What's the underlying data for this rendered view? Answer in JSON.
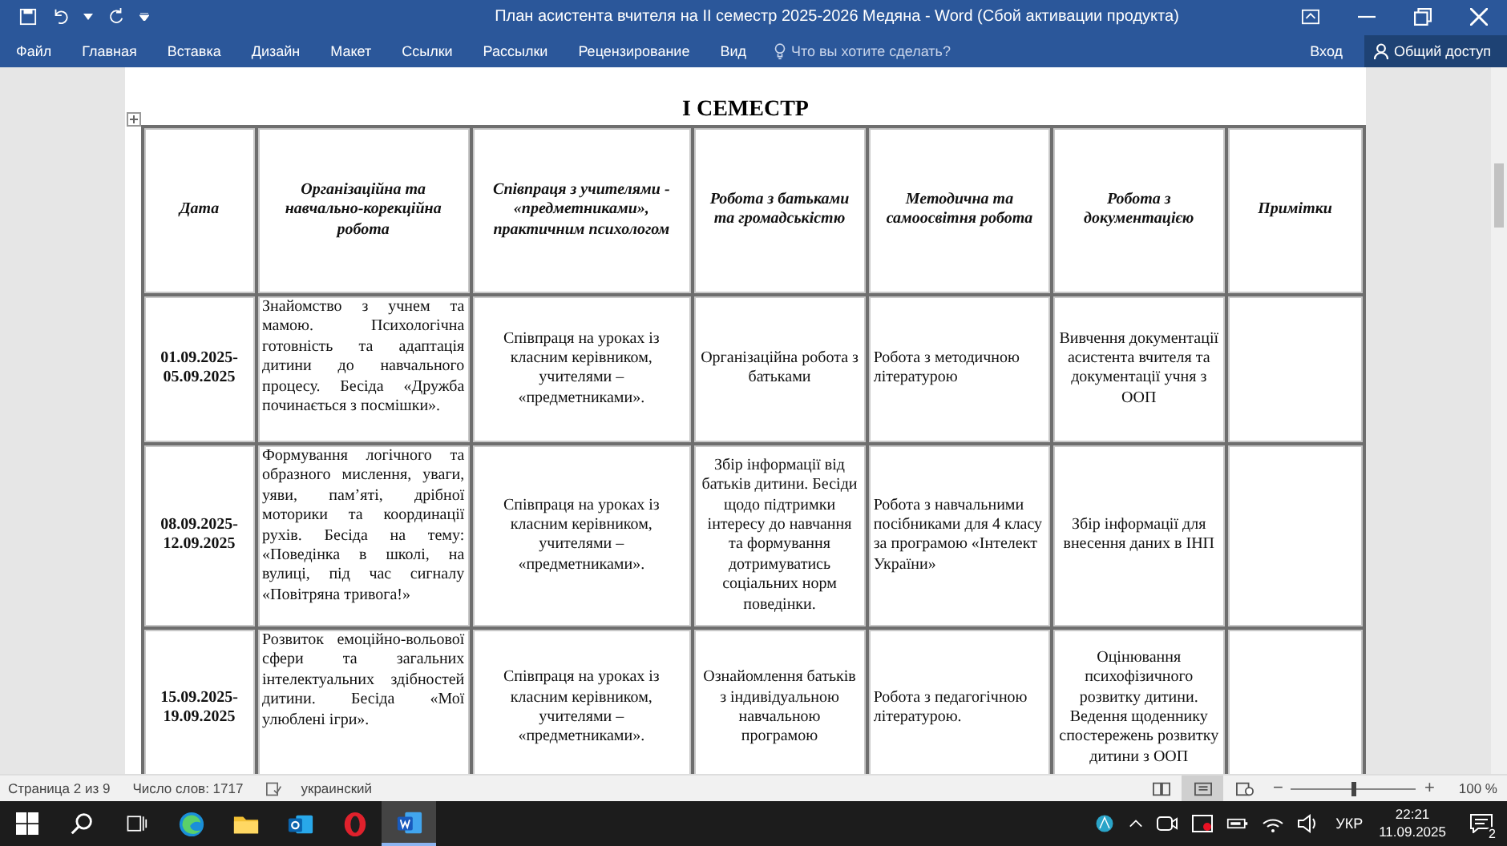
{
  "window": {
    "title": "План асистента вчителя на  ІІ семестр 2025-2026 Медяна - Word (Сбой активации продукта)"
  },
  "ribbon": {
    "tabs": [
      {
        "label": "Файл",
        "selected": false
      },
      {
        "label": "Главная",
        "selected": false
      },
      {
        "label": "Вставка",
        "selected": false
      },
      {
        "label": "Дизайн",
        "selected": false
      },
      {
        "label": "Макет",
        "selected": false
      },
      {
        "label": "Ссылки",
        "selected": false
      },
      {
        "label": "Рассылки",
        "selected": false
      },
      {
        "label": "Рецензирование",
        "selected": false
      },
      {
        "label": "Вид",
        "selected": false
      }
    ],
    "search": {
      "placeholder": "Что вы хотите сделать?"
    },
    "sign_in": "Вход",
    "share": "Общий доступ"
  },
  "document": {
    "heading": "І СЕМЕСТР",
    "table": {
      "columns": [
        "Дата",
        "Організаційна та навчально-корекційна робота",
        "Співпраця з учителями - «предметниками», практичним психологом",
        "Робота з батьками та громадськістю",
        "Методична та самоосвітня робота",
        "Робота з документацією",
        "Примітки"
      ],
      "rows": [
        [
          "01.09.2025-05.09.2025",
          "Знайомство з учнем та мамою. Психологічна готовність та адаптація дитини до навчального процесу. Бесіда «Дружба починається з посмішки».",
          "Співпраця на уроках із класним керівником, учителями – «предметниками».",
          "Організаційна робота з батьками",
          "Робота з методичною літературою",
          "Вивчення документації асистента вчителя та документації учня з ООП",
          ""
        ],
        [
          "08.09.2025-12.09.2025",
          "Формування логічного та образного мислення, уваги, уяви, пам’яті, дрібної моторики та координації рухів. Бесіда на тему: «Поведінка в школі, на вулиці, під час сигналу «Повітряна тривога!»",
          "Співпраця на уроках із класним керівником, учителями – «предметниками».",
          "Збір інформації від батьків дитини. Бесіди щодо підтримки інтересу до навчання та формування дотримуватись соціальних норм поведінки.",
          "Робота з навчальними посібниками для 4 класу за програмою «Інтелект України»",
          "Збір інформації для внесення  даних в ІНП",
          ""
        ],
        [
          "15.09.2025-19.09.2025",
          "Розвиток емоційно-вольової сфери та загальних інтелектуальних здібностей дитини. Бесіда «Мої улюблені ігри».",
          "Співпраця на уроках із класним керівником, учителями – «предметниками».",
          "Ознайомлення батьків з індивідуальною навчальною програмою",
          "Робота з педагогічною літературою.",
          "Оцінювання психофізичного розвитку дитини. Ведення щоденнику спостережень розвитку дитини з ООП",
          ""
        ]
      ]
    }
  },
  "status_bar": {
    "page": "Страница 2 из 9",
    "words": "Число слов: 1717",
    "language": "украинский",
    "views": [
      {
        "kind": "read",
        "selected": false
      },
      {
        "kind": "print",
        "selected": true
      },
      {
        "kind": "web",
        "selected": false
      }
    ],
    "zoom_out": "−",
    "zoom_slider": {
      "level": 0.5
    },
    "zoom_in": "+",
    "zoom": "100 %"
  },
  "taskbar": {
    "apps": [
      {
        "kind": "edge",
        "selected": false
      },
      {
        "kind": "folder",
        "selected": false
      },
      {
        "kind": "outlook",
        "selected": false
      },
      {
        "kind": "opera",
        "selected": false
      },
      {
        "kind": "word",
        "selected": true
      }
    ],
    "language": "УКР",
    "time": "22:21",
    "date": "11.09.2025",
    "notifications": "2"
  }
}
